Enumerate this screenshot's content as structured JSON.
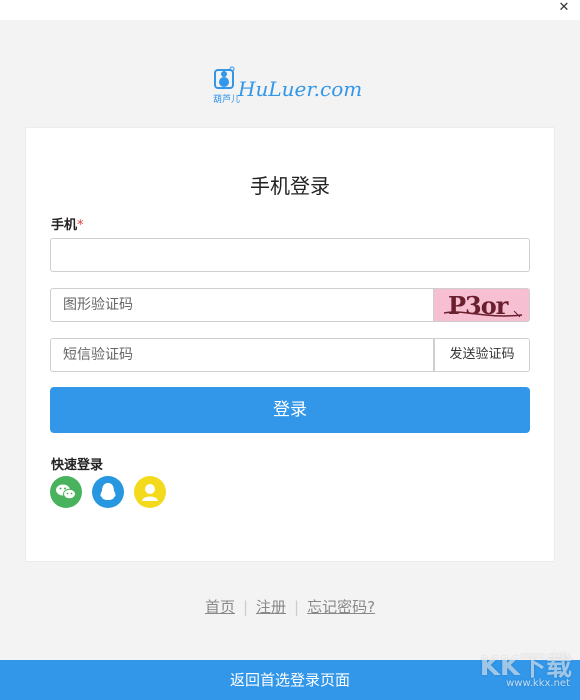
{
  "window": {
    "close_icon": "close-icon"
  },
  "logo": {
    "brand_cn": "葫芦儿",
    "brand_en": "HuLuer.com"
  },
  "card": {
    "title": "手机登录",
    "phone_label": "手机",
    "required_mark": "*",
    "phone_value": "",
    "captcha_placeholder": "图形验证码",
    "captcha_image_text": "P3or",
    "sms_placeholder": "短信验证码",
    "sms_button": "发送验证码",
    "login_button": "登录",
    "quick_login_label": "快速登录",
    "quick_login_icons": [
      "wechat-icon",
      "qq-icon",
      "user-icon"
    ]
  },
  "footer": {
    "links": [
      "首页",
      "注册",
      "忘记密码?"
    ],
    "bottom_button": "返回首选登录页面"
  },
  "watermark": {
    "text": "KK下载",
    "url": "www.kkx.net"
  },
  "colors": {
    "accent": "#3296e9",
    "wechat": "#48b35c",
    "qq": "#2797e0",
    "user": "#f3da1c",
    "required": "#e53935",
    "captcha_bg": "#f7bfd2"
  }
}
